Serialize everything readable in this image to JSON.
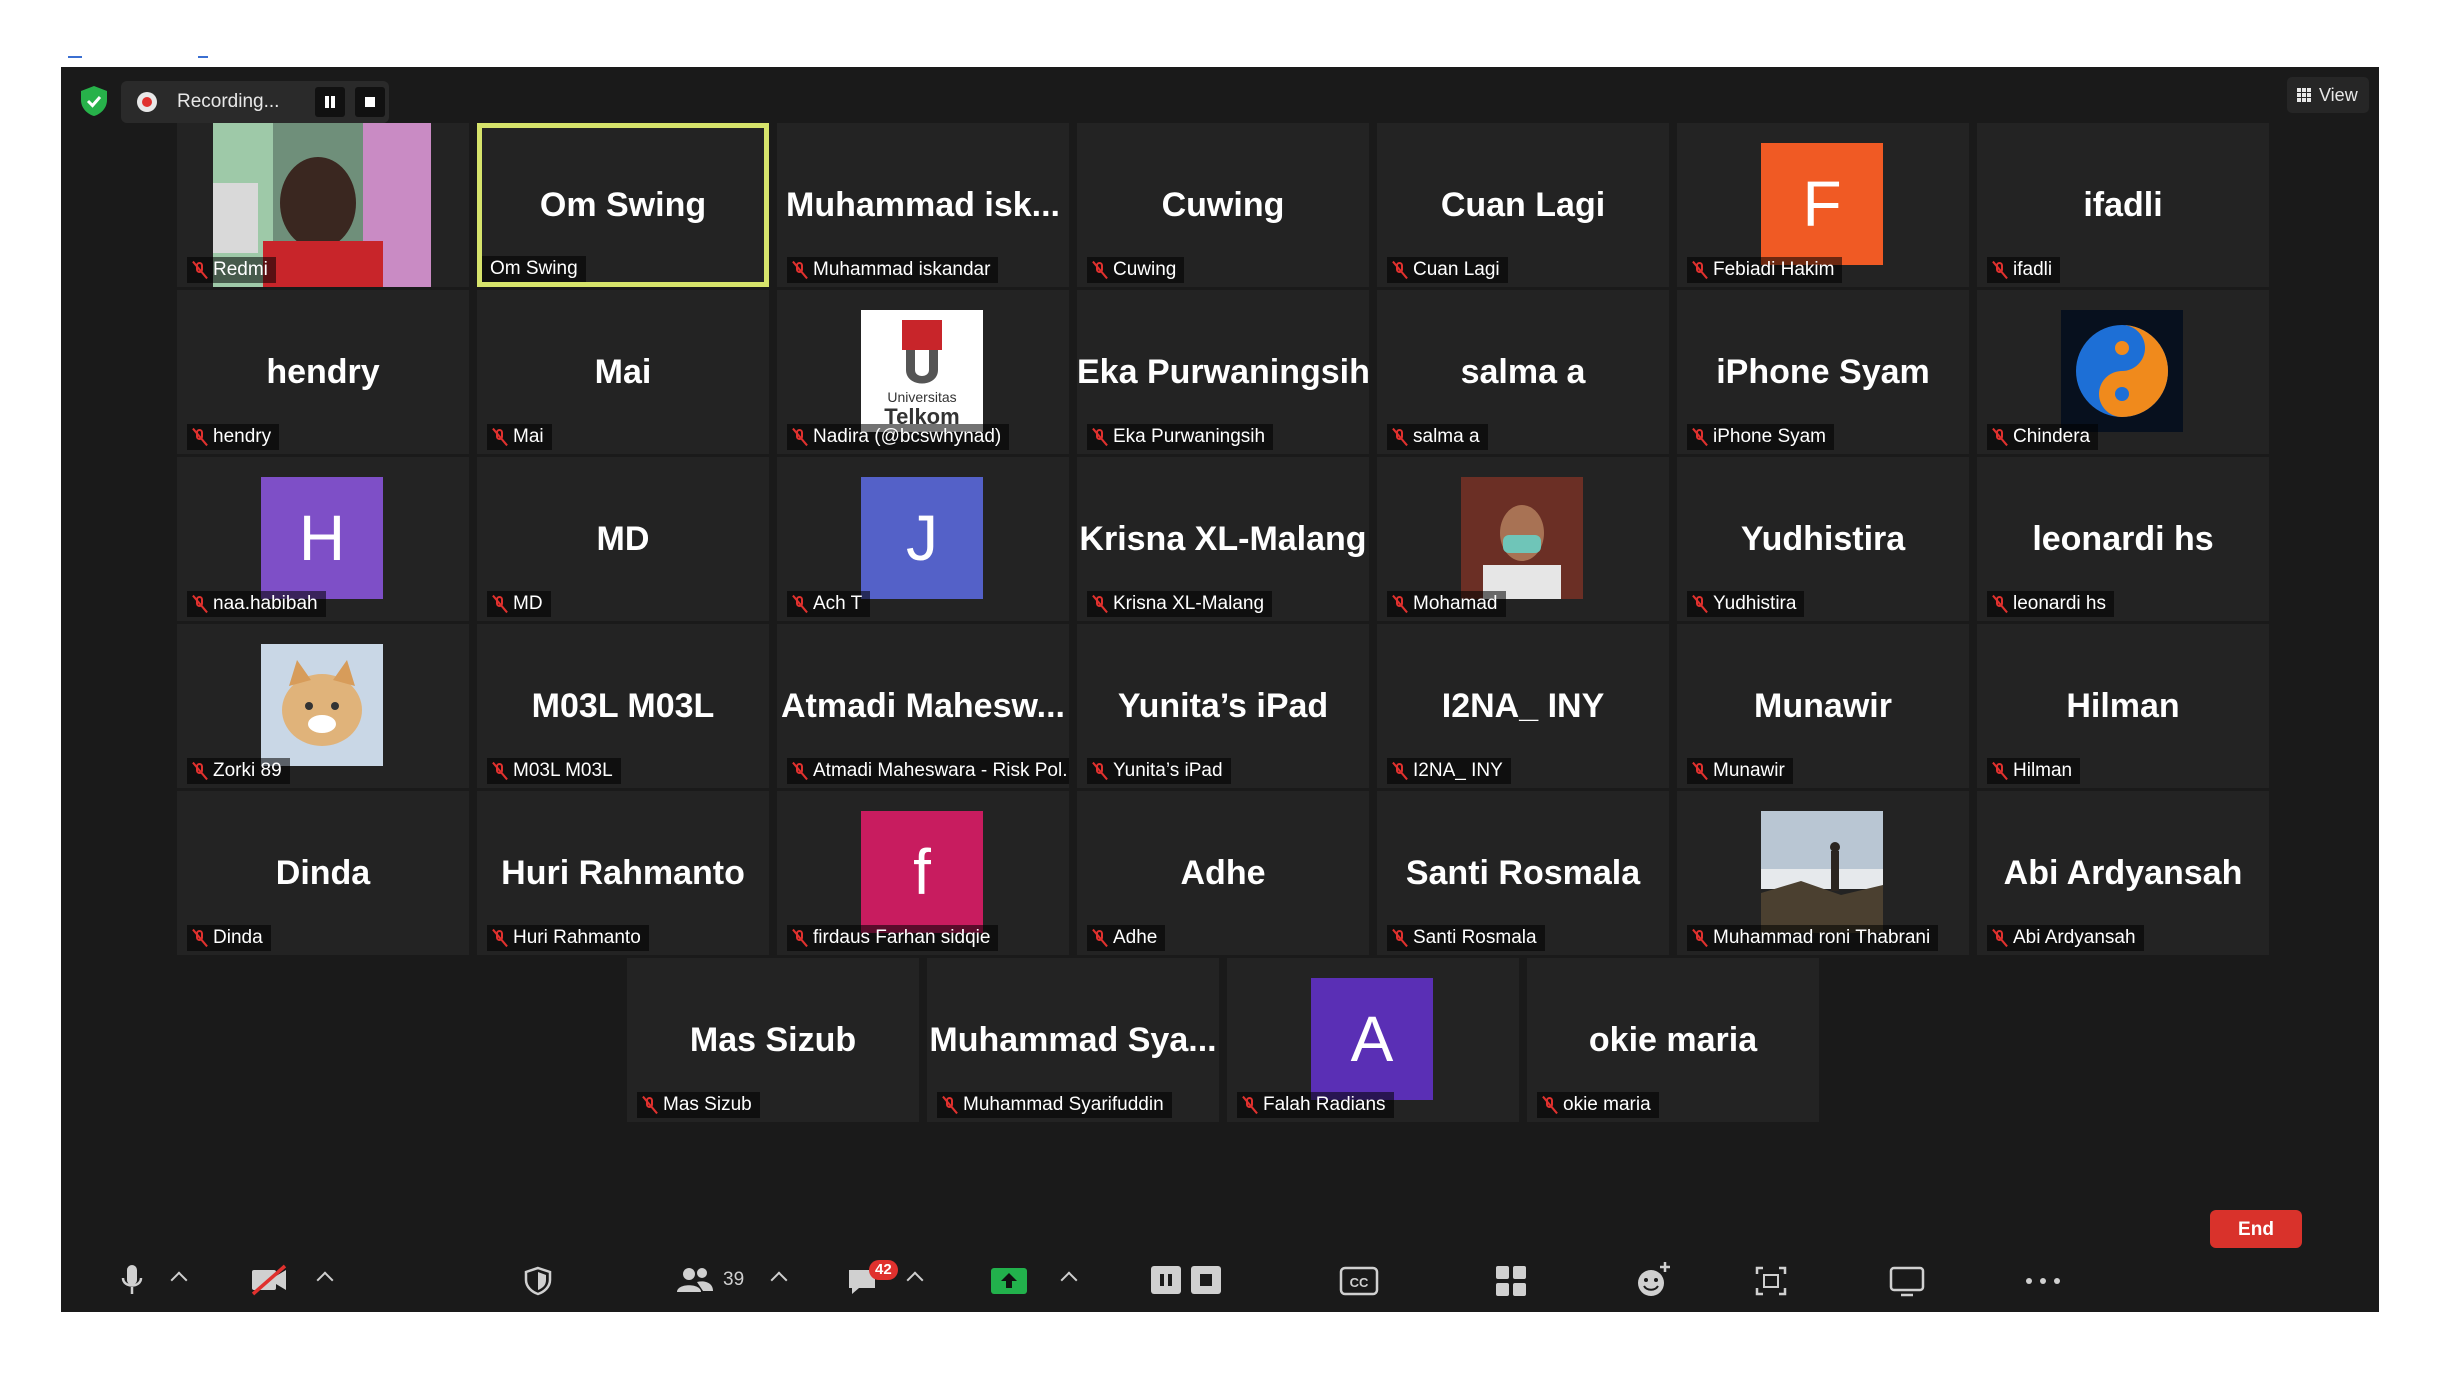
{
  "recording": {
    "label": "Recording..."
  },
  "view": {
    "label": "View"
  },
  "accent": {
    "active_border": "#d6e36b",
    "mute": "#e0312e",
    "end": "#d9322b"
  },
  "rows": [
    [
      {
        "name": "",
        "label": "Redmi",
        "avatar_type": "photo",
        "photo": "man-face"
      },
      {
        "name": "Om Swing",
        "label": "Om Swing",
        "active": true
      },
      {
        "name": "Muhammad  isk...",
        "label": "Muhammad iskandar"
      },
      {
        "name": "Cuwing",
        "label": "Cuwing"
      },
      {
        "name": "Cuan Lagi",
        "label": "Cuan Lagi"
      },
      {
        "name": "",
        "label": "Febiadi Hakim",
        "avatar_letter": "F",
        "avatar_color": "#f05a24"
      },
      {
        "name": "ifadli",
        "label": "ifadli"
      }
    ],
    [
      {
        "name": "hendry",
        "label": "hendry"
      },
      {
        "name": "Mai",
        "label": "Mai"
      },
      {
        "name": "",
        "label": "Nadira (@bcswhynad)",
        "avatar_type": "photo",
        "photo": "telkom-logo",
        "logo_text_1": "Universitas",
        "logo_text_2": "Telkom"
      },
      {
        "name": "Eka Purwaningsih",
        "label": "Eka Purwaningsih"
      },
      {
        "name": "salma a",
        "label": "salma a"
      },
      {
        "name": "iPhone Syam",
        "label": "iPhone Syam"
      },
      {
        "name": "",
        "label": "Chindera",
        "avatar_type": "photo",
        "photo": "yin-yang"
      }
    ],
    [
      {
        "name": "",
        "label": "naa.habibah",
        "avatar_letter": "H",
        "avatar_color": "#7e4fc7"
      },
      {
        "name": "MD",
        "label": "MD"
      },
      {
        "name": "",
        "label": "Ach T",
        "avatar_letter": "J",
        "avatar_color": "#5461c8"
      },
      {
        "name": "Krisna XL-Malang",
        "label": "Krisna XL-Malang"
      },
      {
        "name": "",
        "label": "Mohamad",
        "avatar_type": "photo",
        "photo": "man-mask"
      },
      {
        "name": "Yudhistira",
        "label": "Yudhistira"
      },
      {
        "name": "leonardi hs",
        "label": "leonardi hs"
      }
    ],
    [
      {
        "name": "",
        "label": "Zorki 89",
        "avatar_type": "photo",
        "photo": "cat"
      },
      {
        "name": "M03L M03L",
        "label": "M03L M03L"
      },
      {
        "name": "Atmadi  Mahesw...",
        "label": "Atmadi Maheswara - Risk Pol..."
      },
      {
        "name": "Yunita’s iPad",
        "label": "Yunita’s iPad"
      },
      {
        "name": "I2NA_ INY",
        "label": "I2NA_ INY"
      },
      {
        "name": "Munawir",
        "label": "Munawir"
      },
      {
        "name": "Hilman",
        "label": "Hilman"
      }
    ],
    [
      {
        "name": "Dinda",
        "label": "Dinda"
      },
      {
        "name": "Huri Rahmanto",
        "label": "Huri Rahmanto"
      },
      {
        "name": "",
        "label": "firdaus Farhan sidqie",
        "avatar_letter": "f",
        "avatar_color": "#c81c5f"
      },
      {
        "name": "Adhe",
        "label": "Adhe"
      },
      {
        "name": "Santi Rosmala",
        "label": "Santi Rosmala"
      },
      {
        "name": "",
        "label": "Muhammad roni Thabrani",
        "avatar_type": "photo",
        "photo": "mountain"
      },
      {
        "name": "Abi Ardyansah",
        "label": "Abi Ardyansah"
      }
    ],
    [
      {
        "name": "Mas Sizub",
        "label": "Mas Sizub"
      },
      {
        "name": "Muhammad  Sya...",
        "label": "Muhammad Syarifuddin"
      },
      {
        "name": "",
        "label": "Falah Radians",
        "avatar_letter": "A",
        "avatar_color": "#5a2fb5"
      },
      {
        "name": "okie maria",
        "label": "okie maria"
      }
    ]
  ],
  "toolbar": {
    "participants_count": "39",
    "chat_badge": "42",
    "end_label": "End",
    "icons": [
      "microphone-icon",
      "video-off-icon",
      "security-icon",
      "participants-icon",
      "chat-icon",
      "share-screen-icon",
      "record-icon",
      "captions-icon",
      "apps-icon",
      "reactions-icon",
      "whiteboard-icon",
      "more-icon"
    ]
  }
}
